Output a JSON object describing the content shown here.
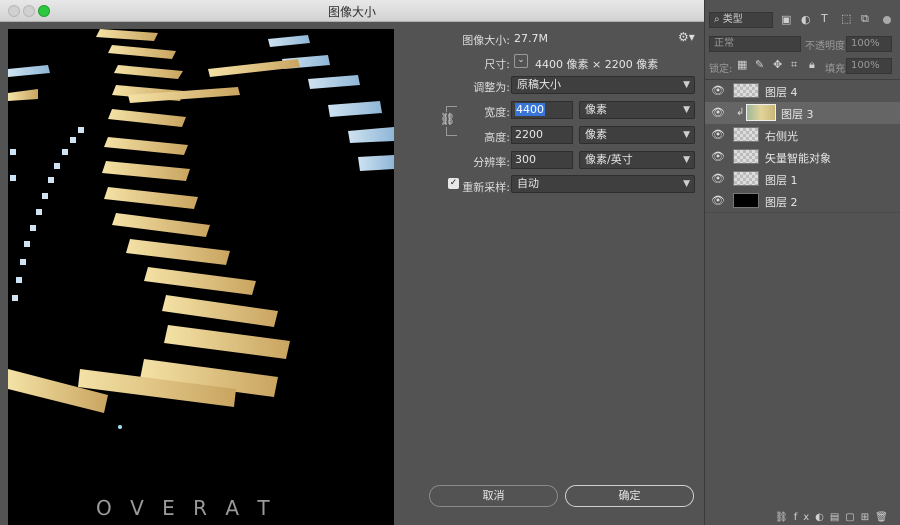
{
  "dialog": {
    "title": "图像大小",
    "image_size_label": "图像大小:",
    "image_size_value": "27.7M",
    "dimensions_label": "尺寸:",
    "dimensions_value": "4400 像素  ×  2200 像素",
    "fit_to_label": "调整为:",
    "fit_to_value": "原稿大小",
    "width_label": "宽度:",
    "width_value": "4400",
    "width_unit": "像素",
    "height_label": "高度:",
    "height_value": "2200",
    "height_unit": "像素",
    "resolution_label": "分辨率:",
    "resolution_value": "300",
    "resolution_unit": "像素/英寸",
    "resample_label": "重新采样:",
    "resample_checked": true,
    "resample_value": "自动",
    "cancel_label": "取消",
    "ok_label": "确定",
    "preview_overlay_text": "O V E R   A T"
  },
  "layers_panel": {
    "kind_filter": "类型",
    "blend_mode": "正常",
    "opacity_label": "不透明度:",
    "opacity_value": "100%",
    "lock_label": "锁定:",
    "fill_label": "填充:",
    "fill_value": "100%",
    "layers": [
      {
        "name": "图层 4",
        "visible": true,
        "thumb": "transparent"
      },
      {
        "name": "图层 3",
        "visible": true,
        "thumb": "gradient",
        "selected": true
      },
      {
        "name": "右侧光",
        "visible": true,
        "thumb": "transparent"
      },
      {
        "name": "矢量智能对象",
        "visible": true,
        "thumb": "transparent"
      },
      {
        "name": "图层 1",
        "visible": true,
        "thumb": "transparent"
      },
      {
        "name": "图层 2",
        "visible": true,
        "thumb": "black"
      }
    ]
  },
  "colors": {
    "accent": "#3875d7",
    "selected_row": "#656565",
    "panel_bg": "#535353",
    "dialog_bg": "#535353"
  }
}
